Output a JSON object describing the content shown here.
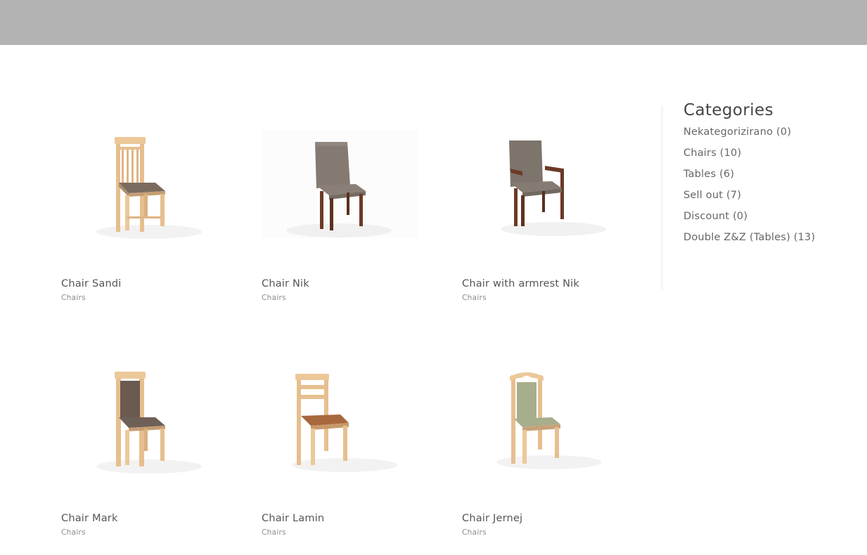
{
  "products": [
    {
      "title": "Chair Sandi",
      "category": "Chairs"
    },
    {
      "title": "Chair Nik",
      "category": "Chairs"
    },
    {
      "title": "Chair with armrest Nik",
      "category": "Chairs"
    },
    {
      "title": "Chair Mark",
      "category": "Chairs"
    },
    {
      "title": "Chair Lamin",
      "category": "Chairs"
    },
    {
      "title": "Chair Jernej",
      "category": "Chairs"
    }
  ],
  "sidebar": {
    "heading": "Categories",
    "items": [
      {
        "label": "Nekategorizirano",
        "count": "(0)"
      },
      {
        "label": "Chairs",
        "count": "(10)"
      },
      {
        "label": "Tables",
        "count": "(6)"
      },
      {
        "label": "Sell out",
        "count": "(7)"
      },
      {
        "label": "Discount",
        "count": "(0)"
      },
      {
        "label": "Double Z&Z (Tables)",
        "count": "(13)"
      }
    ]
  },
  "colors": {
    "header_bar": "#b3b3b3",
    "light_wood": "#e9c394",
    "dark_wood": "#6b3a27",
    "grey_upholstery": "#8a7b70",
    "taupe_upholstery": "#7d746c",
    "brown_fabric": "#6a5a50",
    "rust_fabric": "#a8683f",
    "sage_fabric": "#a7ae8c"
  }
}
